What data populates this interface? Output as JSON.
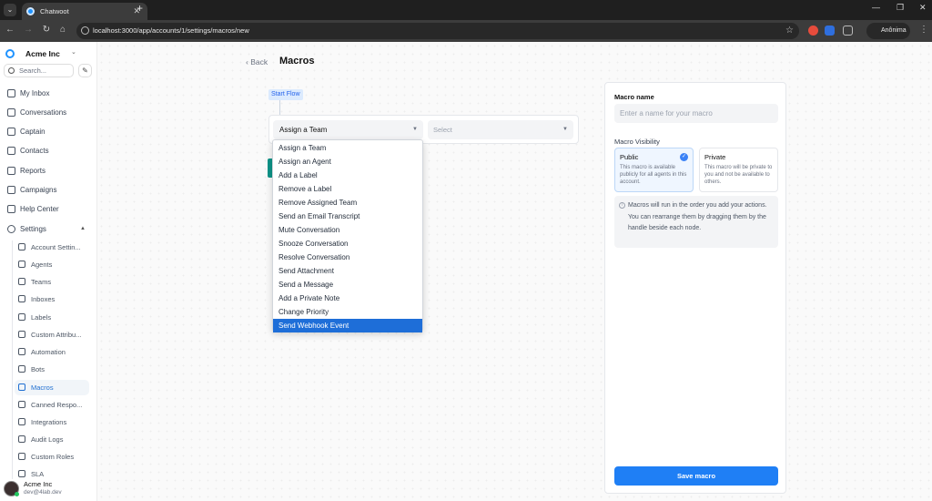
{
  "browser": {
    "tab_title": "Chatwoot",
    "url": "localhost:3000/app/accounts/1/settings/macros/new",
    "profile_label": "Anônima"
  },
  "sidebar": {
    "account_name": "Acme Inc",
    "search_placeholder": "Search...",
    "nav": [
      {
        "label": "My Inbox",
        "icon": "inbox-icon"
      },
      {
        "label": "Conversations",
        "icon": "chat-icon"
      },
      {
        "label": "Captain",
        "icon": "captain-icon"
      },
      {
        "label": "Contacts",
        "icon": "contacts-icon"
      },
      {
        "label": "Reports",
        "icon": "chart-icon"
      },
      {
        "label": "Campaigns",
        "icon": "megaphone-icon"
      },
      {
        "label": "Help Center",
        "icon": "book-icon"
      },
      {
        "label": "Settings",
        "icon": "gear-icon"
      }
    ],
    "settings_items": [
      {
        "label": "Account Settin...",
        "icon": "building-icon"
      },
      {
        "label": "Agents",
        "icon": "agents-icon"
      },
      {
        "label": "Teams",
        "icon": "teams-icon"
      },
      {
        "label": "Inboxes",
        "icon": "inbox-icon"
      },
      {
        "label": "Labels",
        "icon": "tag-icon"
      },
      {
        "label": "Custom Attribu...",
        "icon": "code-icon"
      },
      {
        "label": "Automation",
        "icon": "automation-icon"
      },
      {
        "label": "Bots",
        "icon": "bot-icon"
      },
      {
        "label": "Macros",
        "icon": "macro-icon",
        "active": true
      },
      {
        "label": "Canned Respo...",
        "icon": "canned-icon"
      },
      {
        "label": "Integrations",
        "icon": "integrations-icon"
      },
      {
        "label": "Audit Logs",
        "icon": "audit-icon"
      },
      {
        "label": "Custom Roles",
        "icon": "roles-icon"
      },
      {
        "label": "SLA",
        "icon": "sla-icon"
      }
    ],
    "user": {
      "name": "Acme Inc",
      "email": "dev@4lab.dev"
    }
  },
  "page": {
    "back_label": "Back",
    "title": "Macros",
    "start_flow": "Start Flow",
    "action_select_value": "Assign a Team",
    "value_select_placeholder": "Select",
    "dropdown_options": [
      "Assign a Team",
      "Assign an Agent",
      "Add a Label",
      "Remove a Label",
      "Remove Assigned Team",
      "Send an Email Transcript",
      "Mute Conversation",
      "Snooze Conversation",
      "Resolve Conversation",
      "Send Attachment",
      "Send a Message",
      "Add a Private Note",
      "Change Priority",
      "Send Webhook Event"
    ],
    "highlighted_option": "Send Webhook Event"
  },
  "panel": {
    "name_label": "Macro name",
    "name_placeholder": "Enter a name for your macro",
    "visibility_label": "Macro Visibility",
    "public_title": "Public",
    "public_desc": "This macro is available publicly for all agents in this account.",
    "private_title": "Private",
    "private_desc": "This macro will be private to you and not be available to others.",
    "info_text": "Macros will run in the order you add your actions. You can rearrange them by dragging them by the handle beside each node.",
    "save_label": "Save macro"
  },
  "colors": {
    "accent": "#1f7ff5",
    "highlight": "#1e6ed8",
    "teal": "#0d9488"
  }
}
